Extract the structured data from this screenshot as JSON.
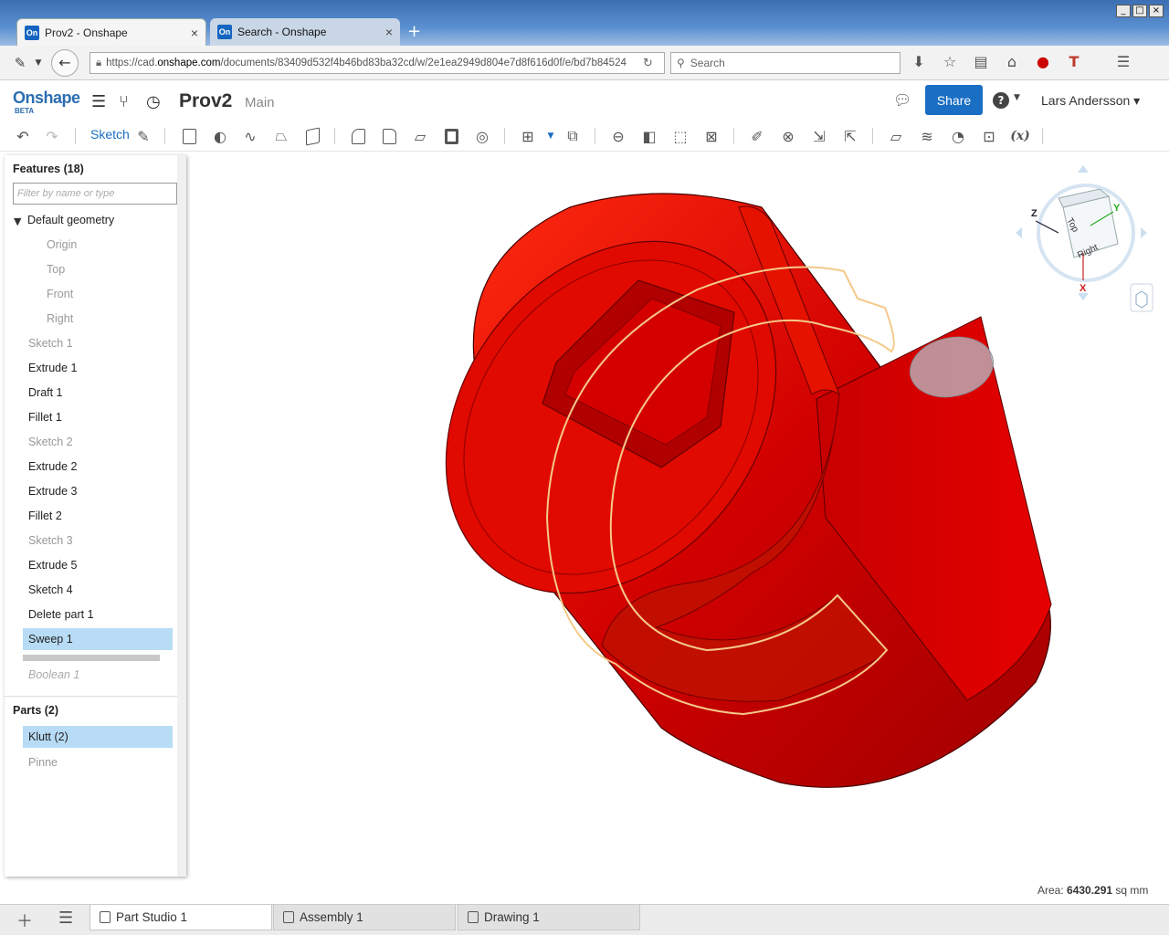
{
  "browser": {
    "tabs": [
      {
        "favicon": "On",
        "title": "Prov2 - Onshape",
        "close": "×"
      },
      {
        "favicon": "On",
        "title": "Search - Onshape",
        "close": "×"
      }
    ],
    "new_tab": "+",
    "url_prefix": "https://cad.",
    "url_domain": "onshape.com",
    "url_rest": "/documents/83409d532f4b46bd83ba32cd/w/2e1ea2949d804e7d8f616d0f/e/bd7b84524",
    "search_placeholder": "Search",
    "window_buttons": [
      "_",
      "□",
      "×"
    ]
  },
  "app": {
    "logo": "Onshape",
    "logo_beta": "BETA",
    "doc_title": "Prov2",
    "doc_branch": "Main",
    "share_label": "Share",
    "help_label": "?",
    "user_name": "Lars Andersson ▾"
  },
  "toolbar": {
    "sketch_label": "Sketch"
  },
  "features": {
    "title": "Features (18)",
    "filter_placeholder": "Filter by name or type",
    "default_geometry": "Default geometry",
    "planes": [
      "Origin",
      "Top",
      "Front",
      "Right"
    ],
    "items": [
      {
        "label": "Sketch 1",
        "state": "dim"
      },
      {
        "label": "Extrude 1",
        "state": "plain"
      },
      {
        "label": "Draft 1",
        "state": "plain"
      },
      {
        "label": "Fillet 1",
        "state": "plain"
      },
      {
        "label": "Sketch 2",
        "state": "dim"
      },
      {
        "label": "Extrude 2",
        "state": "plain"
      },
      {
        "label": "Extrude 3",
        "state": "plain"
      },
      {
        "label": "Fillet 2",
        "state": "plain"
      },
      {
        "label": "Sketch 3",
        "state": "dim"
      },
      {
        "label": "Extrude 5",
        "state": "plain"
      },
      {
        "label": "Sketch 4",
        "state": "plain"
      },
      {
        "label": "Delete part 1",
        "state": "plain"
      },
      {
        "label": "Sweep 1",
        "state": "selected"
      }
    ],
    "rolled_back": "Boolean 1"
  },
  "parts": {
    "title": "Parts (2)",
    "items": [
      {
        "label": "Klutt (2)",
        "state": "selected"
      },
      {
        "label": "Pinne",
        "state": "dim"
      }
    ]
  },
  "view_cube": {
    "top": "Top",
    "right": "Right",
    "axis_x": "X",
    "axis_y": "Y",
    "axis_z": "Z"
  },
  "status": {
    "area_label": "Area: ",
    "area_value": "6430.291",
    "area_unit": " sq mm"
  },
  "bottom_tabs": [
    {
      "label": "Part Studio 1",
      "active": true
    },
    {
      "label": "Assembly 1",
      "active": false
    },
    {
      "label": "Drawing 1",
      "active": false
    }
  ],
  "colors": {
    "part_red": "#d40000",
    "accent_blue": "#1a6fc4",
    "selection": "#b8dcf6"
  }
}
